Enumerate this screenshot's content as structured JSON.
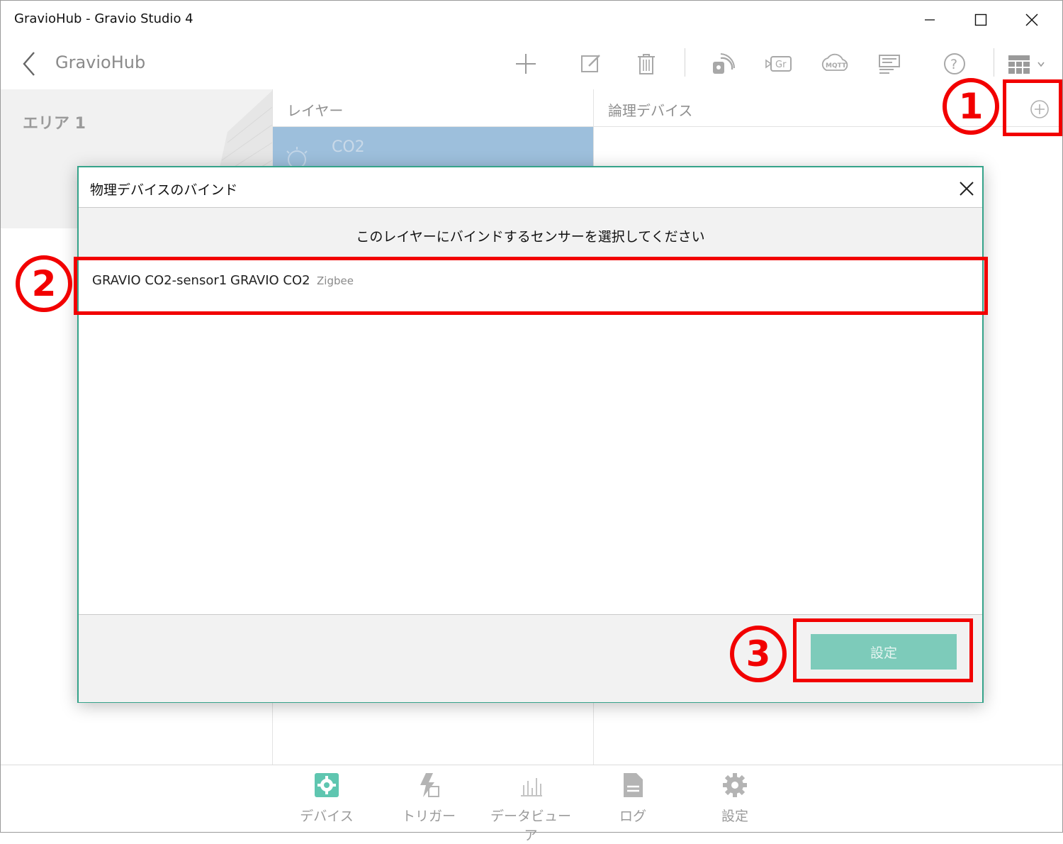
{
  "window": {
    "title": "GravioHub - Gravio Studio 4"
  },
  "header": {
    "title": "GravioHub",
    "toolbar": [
      "add-icon",
      "edit-icon",
      "delete-icon",
      "sensor-icon",
      "gravio-hub-icon",
      "mqtt-icon",
      "list-icon",
      "help-icon",
      "view-mode-icon"
    ]
  },
  "area": {
    "label": "エリア 1"
  },
  "columns": {
    "layer": "レイヤー",
    "logical_device": "論理デバイス"
  },
  "layer_item": {
    "name": "CO2"
  },
  "dialog": {
    "title": "物理デバイスのバインド",
    "instruction": "このレイヤーにバインドするセンサーを選択してください",
    "sensor": {
      "name": "GRAVIO CO2-sensor1",
      "model": "GRAVIO CO2",
      "protocol": "Zigbee"
    },
    "ok_label": "設定"
  },
  "bottom_nav": [
    {
      "label": "デバイス",
      "icon": "device-gear-icon",
      "active": true
    },
    {
      "label": "トリガー",
      "icon": "trigger-icon",
      "active": false
    },
    {
      "label": "データビューア",
      "icon": "data-viewer-icon",
      "active": false
    },
    {
      "label": "ログ",
      "icon": "log-icon",
      "active": false
    },
    {
      "label": "設定",
      "icon": "settings-gear-icon",
      "active": false
    }
  ],
  "annotations": {
    "marker1": "1",
    "marker2": "2",
    "marker3": "3",
    "color": "#f20000"
  },
  "colors": {
    "accent": "#35a38a",
    "button": "#7dcbba",
    "layer_selected": "#9dbfdc"
  }
}
